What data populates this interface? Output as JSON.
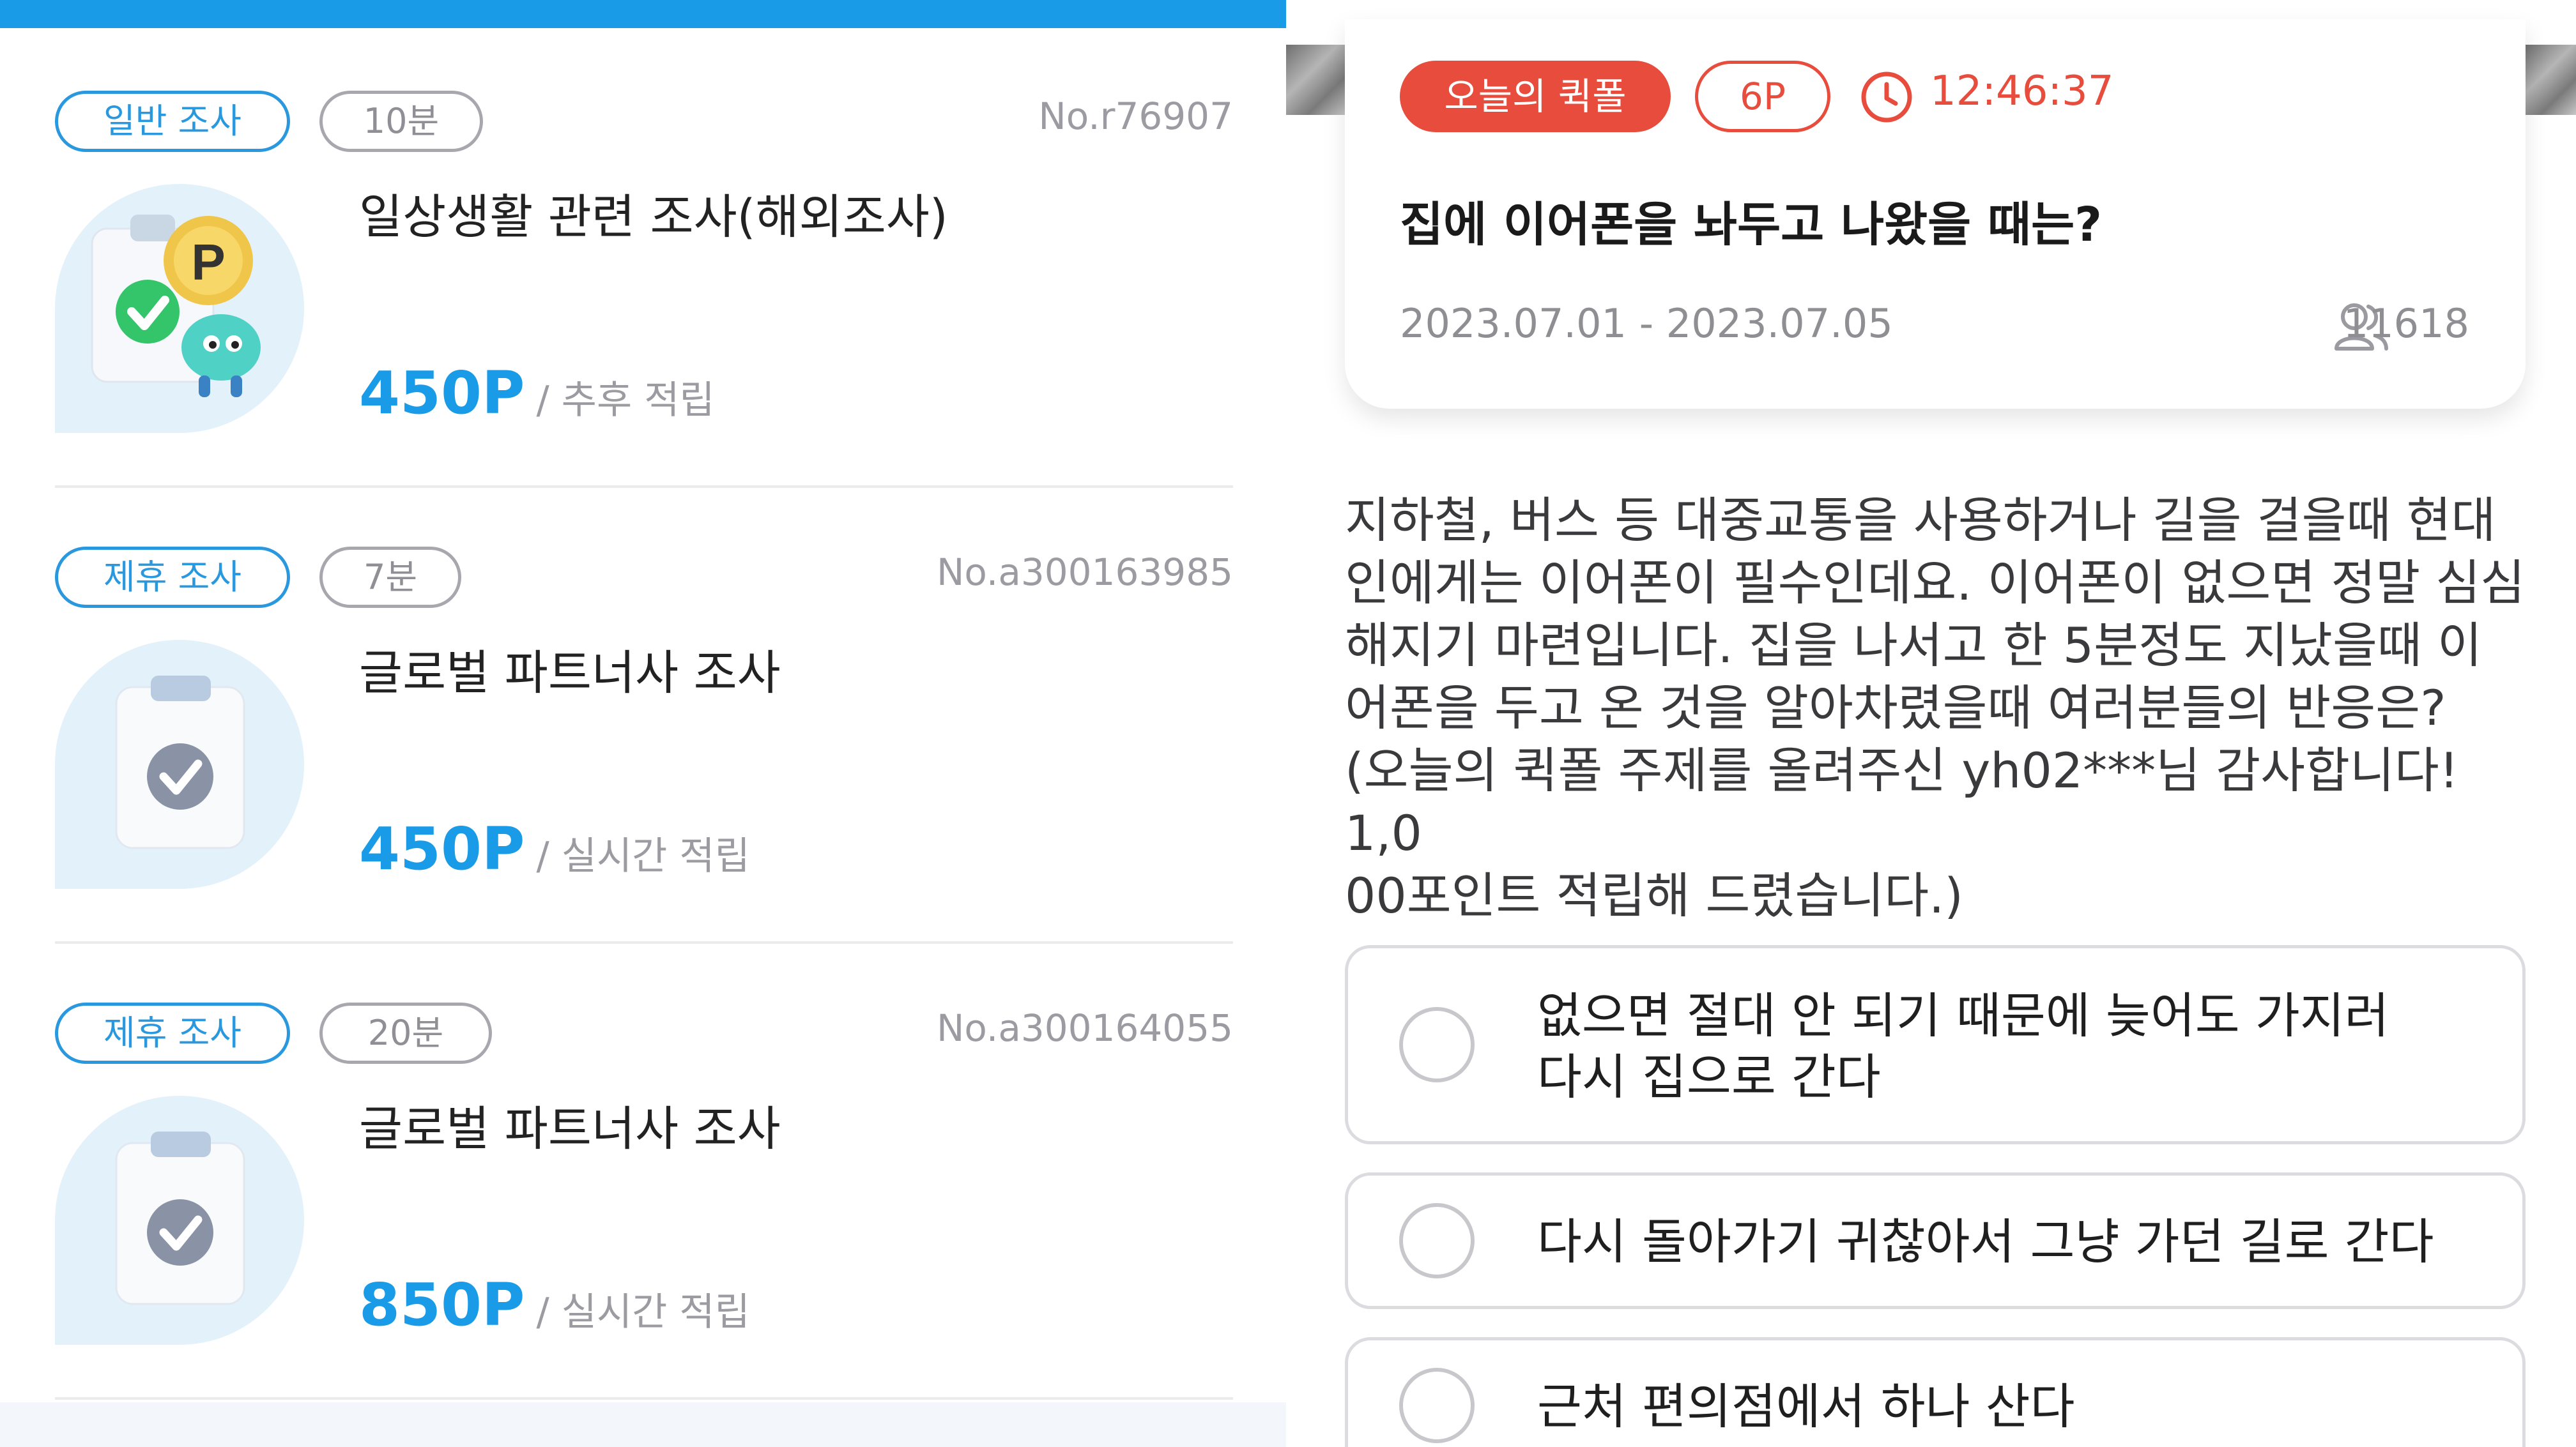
{
  "survey_list": {
    "items": [
      {
        "tag": "일반 조사",
        "time": "10분",
        "number": "No.r76907",
        "title": "일상생활 관련 조사(해외조사)",
        "points": "450P",
        "reward_note": "/ 추후 적립",
        "thumbnail": "clipboard-coin-mascot-icon"
      },
      {
        "tag": "제휴 조사",
        "time": "7분",
        "number": "No.a300163985",
        "title": "글로벌 파트너사 조사",
        "points": "450P",
        "reward_note": "/ 실시간 적립",
        "thumbnail": "clipboard-check-icon"
      },
      {
        "tag": "제휴 조사",
        "time": "20분",
        "number": "No.a300164055",
        "title": "글로벌 파트너사 조사",
        "points": "850P",
        "reward_note": "/ 실시간 적립",
        "thumbnail": "clipboard-check-icon"
      }
    ]
  },
  "quick_poll": {
    "tag": "오늘의 퀵폴",
    "points": "6P",
    "timer": "12:46:37",
    "question": "집에 이어폰을 놔두고 나왔을 때는?",
    "period": "2023.07.01 - 2023.07.05",
    "participants": "11618",
    "description": "지하철, 버스 등 대중교통을 사용하거나 길을 걸을때 현대\n인에게는 이어폰이 필수인데요. 이어폰이 없으면 정말 심심\n해지기 마련입니다.  집을 나서고 한 5분정도 지났을때 이\n어폰을 두고 온 것을 알아차렸을때 여러분들의 반응은?\n(오늘의 퀵폴 주제를 올려주신 yh02***님 감사합니다! 1,0\n00포인트 적립해 드렸습니다.)",
    "options": [
      {
        "label": "없으면 절대 안 되기 때문에 늦어도 가지러\n다시 집으로 간다"
      },
      {
        "label": "다시 돌아가기 귀찮아서 그냥 가던 길로 간다"
      },
      {
        "label": "근처 편의점에서 하나 산다"
      }
    ]
  },
  "colors": {
    "primary_blue": "#1a9be8",
    "accent_red": "#e74c3c"
  }
}
